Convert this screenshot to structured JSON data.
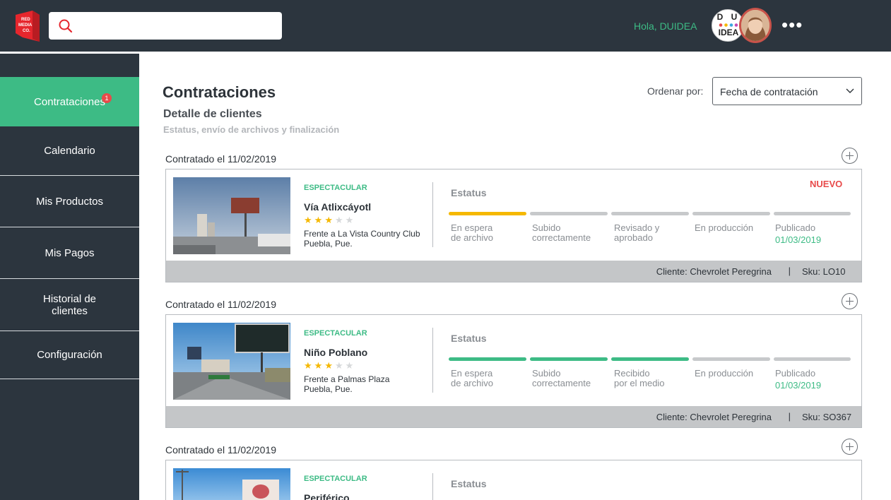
{
  "brand": {
    "logo_text": "RED MEDIA CO."
  },
  "header": {
    "search_placeholder": "",
    "greeting": "Hola, DUIDEA",
    "brand_avatar_text_top": "D U",
    "brand_avatar_text_bottom": "IDEA",
    "more_label": "•••"
  },
  "sidebar": {
    "items": [
      {
        "label": "Contrataciones",
        "badge": "1",
        "active": true
      },
      {
        "label": "Calendario"
      },
      {
        "label": "Mis Productos"
      },
      {
        "label": "Mis Pagos"
      },
      {
        "label": "Historial de clientes"
      },
      {
        "label": "Configuración"
      }
    ]
  },
  "main": {
    "title": "Contrataciones",
    "subtitle": "Detalle de clientes",
    "description": "Estatus, envío de archivos y finalización",
    "sort": {
      "label": "Ordenar por:",
      "value": "Fecha de contratación"
    },
    "status_title": "Estatus",
    "contracts": [
      {
        "date_label": "Contratado el 11/02/2019",
        "category": "ESPECTACULAR",
        "name": "Vía Atlixcáyotl",
        "rating": 3,
        "rating_max": 5,
        "address_line1": "Frente a La Vista Country Club",
        "address_line2": "Puebla, Pue.",
        "tag": "NUEVO",
        "steps": [
          {
            "line1": "En espera",
            "line2": "de archivo",
            "state": "current"
          },
          {
            "line1": "Subido",
            "line2": "correctamente",
            "state": "pending"
          },
          {
            "line1": "Revisado y",
            "line2": "aprobado",
            "state": "pending"
          },
          {
            "line1": "En producción",
            "line2": "",
            "state": "pending"
          },
          {
            "line1": "Publicado",
            "date": "01/03/2019",
            "state": "pending"
          }
        ],
        "client": "Cliente: Chevrolet Peregrina",
        "separator": "|",
        "sku": "Sku: LO10"
      },
      {
        "date_label": "Contratado el 11/02/2019",
        "category": "ESPECTACULAR",
        "name": "Niño Poblano",
        "rating": 3,
        "rating_max": 5,
        "address_line1": "Frente a Palmas Plaza",
        "address_line2": "Puebla, Pue.",
        "tag": "",
        "steps": [
          {
            "line1": "En espera",
            "line2": "de archivo",
            "state": "done"
          },
          {
            "line1": "Subido",
            "line2": "correctamente",
            "state": "done"
          },
          {
            "line1": "Recibido",
            "line2": "por el medio",
            "state": "done"
          },
          {
            "line1": "En producción",
            "line2": "",
            "state": "pending"
          },
          {
            "line1": "Publicado",
            "date": "01/03/2019",
            "state": "pending"
          }
        ],
        "client": "Cliente: Chevrolet Peregrina",
        "separator": "|",
        "sku": "Sku: SO367"
      },
      {
        "date_label": "Contratado el 11/02/2019",
        "category": "ESPECTACULAR",
        "name": "Periférico"
      }
    ]
  },
  "colors": {
    "dark": "#2c353e",
    "accent_green": "#3dbb85",
    "accent_yellow": "#f5b800",
    "alert_red": "#e84a4a"
  }
}
